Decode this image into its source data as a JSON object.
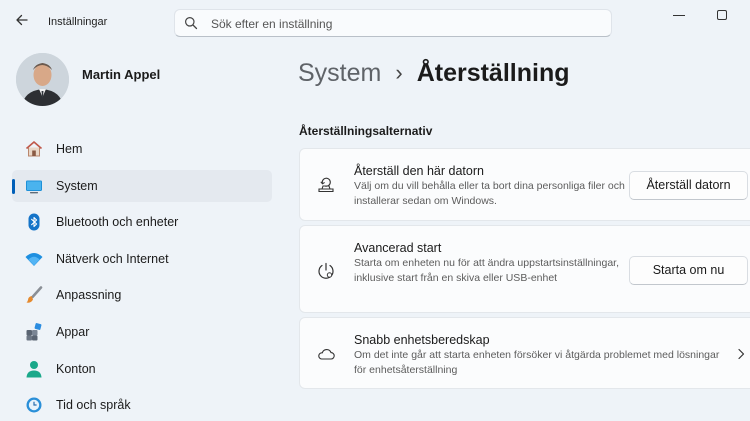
{
  "window": {
    "title": "Inställningar"
  },
  "search": {
    "placeholder": "Sök efter en inställning"
  },
  "user": {
    "name": "Martin Appel"
  },
  "sidebar": {
    "items": [
      {
        "label": "Hem",
        "icon": "home-icon",
        "active": false
      },
      {
        "label": "System",
        "icon": "system-icon",
        "active": true
      },
      {
        "label": "Bluetooth och enheter",
        "icon": "bluetooth-icon",
        "active": false
      },
      {
        "label": "Nätverk och Internet",
        "icon": "wifi-icon",
        "active": false
      },
      {
        "label": "Anpassning",
        "icon": "brush-icon",
        "active": false
      },
      {
        "label": "Appar",
        "icon": "apps-icon",
        "active": false
      },
      {
        "label": "Konton",
        "icon": "account-icon",
        "active": false
      },
      {
        "label": "Tid och språk",
        "icon": "clock-globe-icon",
        "active": false
      }
    ]
  },
  "breadcrumb": {
    "parent": "System",
    "separator": "›",
    "current": "Återställning"
  },
  "section": {
    "title": "Återställningsalternativ"
  },
  "cards": [
    {
      "title": "Återställ den här datorn",
      "description": "Välj om du vill behålla eller ta bort dina personliga filer och installerar sedan om Windows.",
      "button": "Återställ datorn",
      "icon": "reset-pc-icon"
    },
    {
      "title": "Avancerad start",
      "description": "Starta om enheten nu för att ändra uppstartsinställningar, inklusive start från en skiva eller USB-enhet",
      "button": "Starta om nu",
      "icon": "advanced-startup-icon"
    },
    {
      "title": "Snabb enhetsberedskap",
      "description": "Om det inte går att starta enheten försöker vi åtgärda problemet med lösningar för enhetsåterställning",
      "icon": "cloud-icon"
    }
  ],
  "colors": {
    "accent": "#005fb8",
    "background": "#eef3f8"
  }
}
